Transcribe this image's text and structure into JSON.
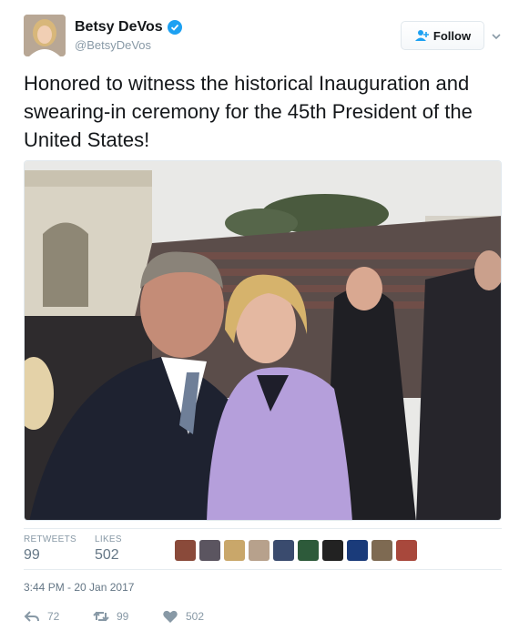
{
  "user": {
    "display_name": "Betsy DeVos",
    "handle": "@BetsyDeVos",
    "verified": true
  },
  "follow_button": {
    "label": "Follow"
  },
  "tweet": {
    "text": "Honored to witness the historical Inauguration and swearing-in ceremony for the 45th President of the United States!"
  },
  "stats": {
    "retweets_label": "RETWEETS",
    "retweets_value": "99",
    "likes_label": "LIKES",
    "likes_value": "502",
    "liker_avatar_count": 10
  },
  "timestamp": "3:44 PM - 20 Jan 2017",
  "actions": {
    "reply_count": "72",
    "retweet_count": "99",
    "like_count": "502"
  },
  "colors": {
    "verified": "#1da1f2",
    "muted": "#8899a6",
    "text": "#14171a",
    "border": "#e1e8ed"
  },
  "icons": [
    "verified-icon",
    "follow-person-icon",
    "chevron-down-icon",
    "reply-icon",
    "retweet-icon",
    "heart-icon"
  ]
}
